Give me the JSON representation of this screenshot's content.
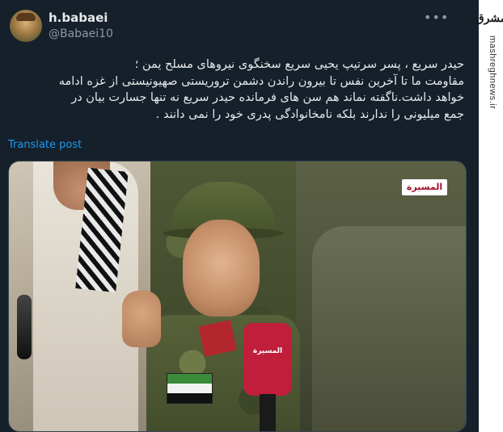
{
  "tweet": {
    "display_name": "h.babaei",
    "handle": "@Babaei10",
    "text_lines": [
      "حیدر سریع ، پسر سرتیپ یحیی سریع سخنگوی نیروهای مسلح یمن ؛",
      "مقاومت ما تا آخرین نفس تا بیرون راندن دشمن تروریستی صهیونیستی از غزه ادامه",
      "خواهد داشت.ناگفته نماند هم سن های فرمانده حیدر سریع نه تنها جسارت بیان در",
      "جمع میلیونی را ندارند بلکه نامخانوادگی پدری خود را نمی دانند ."
    ],
    "translate_label": "Translate post",
    "more_icon": "more-options-icon"
  },
  "media": {
    "channel_logo_text": "المسيرة",
    "mic_label_text": "المسيرة"
  },
  "watermark": {
    "logo_text": "مشرق",
    "site_text": "mashreghnews.ir"
  },
  "colors": {
    "background": "#15202b",
    "text": "#e7e9ea",
    "muted": "#8b98a5",
    "link": "#1d9bf0"
  }
}
